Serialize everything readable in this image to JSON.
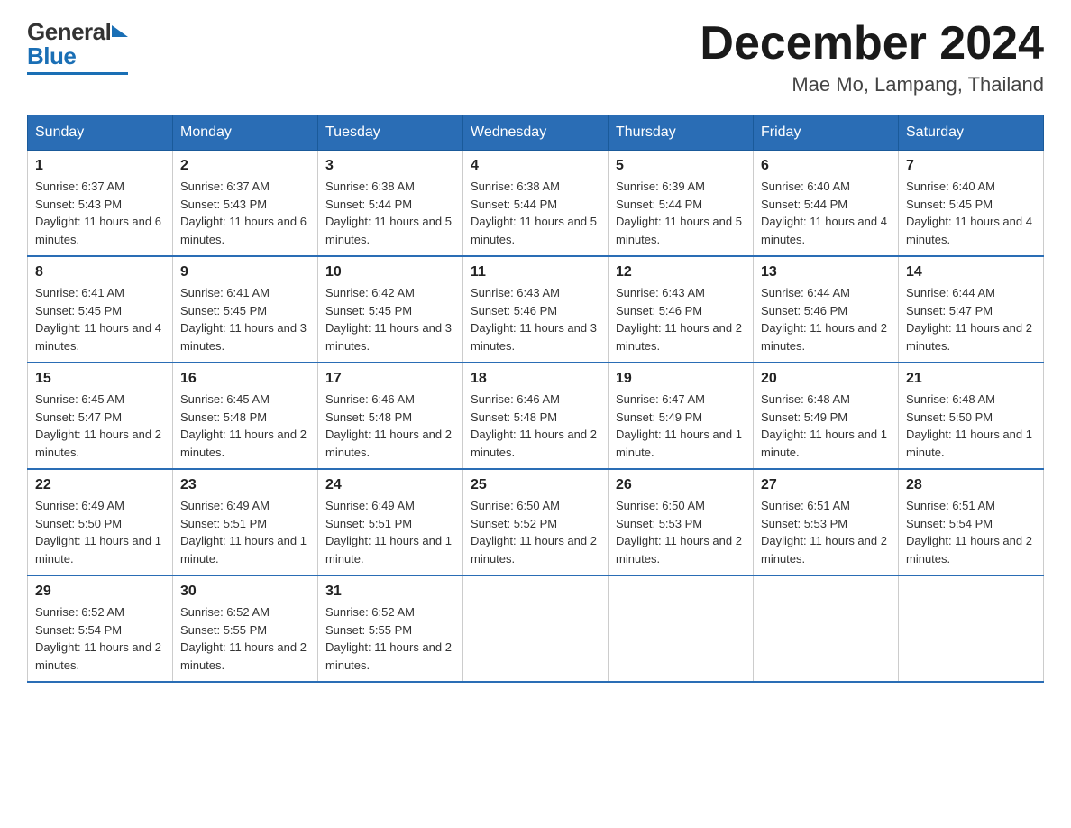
{
  "logo": {
    "general": "General",
    "blue": "Blue"
  },
  "header": {
    "month": "December 2024",
    "location": "Mae Mo, Lampang, Thailand"
  },
  "days_of_week": [
    "Sunday",
    "Monday",
    "Tuesday",
    "Wednesday",
    "Thursday",
    "Friday",
    "Saturday"
  ],
  "weeks": [
    [
      {
        "day": "1",
        "sunrise": "6:37 AM",
        "sunset": "5:43 PM",
        "daylight": "11 hours and 6 minutes."
      },
      {
        "day": "2",
        "sunrise": "6:37 AM",
        "sunset": "5:43 PM",
        "daylight": "11 hours and 6 minutes."
      },
      {
        "day": "3",
        "sunrise": "6:38 AM",
        "sunset": "5:44 PM",
        "daylight": "11 hours and 5 minutes."
      },
      {
        "day": "4",
        "sunrise": "6:38 AM",
        "sunset": "5:44 PM",
        "daylight": "11 hours and 5 minutes."
      },
      {
        "day": "5",
        "sunrise": "6:39 AM",
        "sunset": "5:44 PM",
        "daylight": "11 hours and 5 minutes."
      },
      {
        "day": "6",
        "sunrise": "6:40 AM",
        "sunset": "5:44 PM",
        "daylight": "11 hours and 4 minutes."
      },
      {
        "day": "7",
        "sunrise": "6:40 AM",
        "sunset": "5:45 PM",
        "daylight": "11 hours and 4 minutes."
      }
    ],
    [
      {
        "day": "8",
        "sunrise": "6:41 AM",
        "sunset": "5:45 PM",
        "daylight": "11 hours and 4 minutes."
      },
      {
        "day": "9",
        "sunrise": "6:41 AM",
        "sunset": "5:45 PM",
        "daylight": "11 hours and 3 minutes."
      },
      {
        "day": "10",
        "sunrise": "6:42 AM",
        "sunset": "5:45 PM",
        "daylight": "11 hours and 3 minutes."
      },
      {
        "day": "11",
        "sunrise": "6:43 AM",
        "sunset": "5:46 PM",
        "daylight": "11 hours and 3 minutes."
      },
      {
        "day": "12",
        "sunrise": "6:43 AM",
        "sunset": "5:46 PM",
        "daylight": "11 hours and 2 minutes."
      },
      {
        "day": "13",
        "sunrise": "6:44 AM",
        "sunset": "5:46 PM",
        "daylight": "11 hours and 2 minutes."
      },
      {
        "day": "14",
        "sunrise": "6:44 AM",
        "sunset": "5:47 PM",
        "daylight": "11 hours and 2 minutes."
      }
    ],
    [
      {
        "day": "15",
        "sunrise": "6:45 AM",
        "sunset": "5:47 PM",
        "daylight": "11 hours and 2 minutes."
      },
      {
        "day": "16",
        "sunrise": "6:45 AM",
        "sunset": "5:48 PM",
        "daylight": "11 hours and 2 minutes."
      },
      {
        "day": "17",
        "sunrise": "6:46 AM",
        "sunset": "5:48 PM",
        "daylight": "11 hours and 2 minutes."
      },
      {
        "day": "18",
        "sunrise": "6:46 AM",
        "sunset": "5:48 PM",
        "daylight": "11 hours and 2 minutes."
      },
      {
        "day": "19",
        "sunrise": "6:47 AM",
        "sunset": "5:49 PM",
        "daylight": "11 hours and 1 minute."
      },
      {
        "day": "20",
        "sunrise": "6:48 AM",
        "sunset": "5:49 PM",
        "daylight": "11 hours and 1 minute."
      },
      {
        "day": "21",
        "sunrise": "6:48 AM",
        "sunset": "5:50 PM",
        "daylight": "11 hours and 1 minute."
      }
    ],
    [
      {
        "day": "22",
        "sunrise": "6:49 AM",
        "sunset": "5:50 PM",
        "daylight": "11 hours and 1 minute."
      },
      {
        "day": "23",
        "sunrise": "6:49 AM",
        "sunset": "5:51 PM",
        "daylight": "11 hours and 1 minute."
      },
      {
        "day": "24",
        "sunrise": "6:49 AM",
        "sunset": "5:51 PM",
        "daylight": "11 hours and 1 minute."
      },
      {
        "day": "25",
        "sunrise": "6:50 AM",
        "sunset": "5:52 PM",
        "daylight": "11 hours and 2 minutes."
      },
      {
        "day": "26",
        "sunrise": "6:50 AM",
        "sunset": "5:53 PM",
        "daylight": "11 hours and 2 minutes."
      },
      {
        "day": "27",
        "sunrise": "6:51 AM",
        "sunset": "5:53 PM",
        "daylight": "11 hours and 2 minutes."
      },
      {
        "day": "28",
        "sunrise": "6:51 AM",
        "sunset": "5:54 PM",
        "daylight": "11 hours and 2 minutes."
      }
    ],
    [
      {
        "day": "29",
        "sunrise": "6:52 AM",
        "sunset": "5:54 PM",
        "daylight": "11 hours and 2 minutes."
      },
      {
        "day": "30",
        "sunrise": "6:52 AM",
        "sunset": "5:55 PM",
        "daylight": "11 hours and 2 minutes."
      },
      {
        "day": "31",
        "sunrise": "6:52 AM",
        "sunset": "5:55 PM",
        "daylight": "11 hours and 2 minutes."
      },
      null,
      null,
      null,
      null
    ]
  ],
  "labels": {
    "sunrise": "Sunrise:",
    "sunset": "Sunset:",
    "daylight": "Daylight:"
  }
}
